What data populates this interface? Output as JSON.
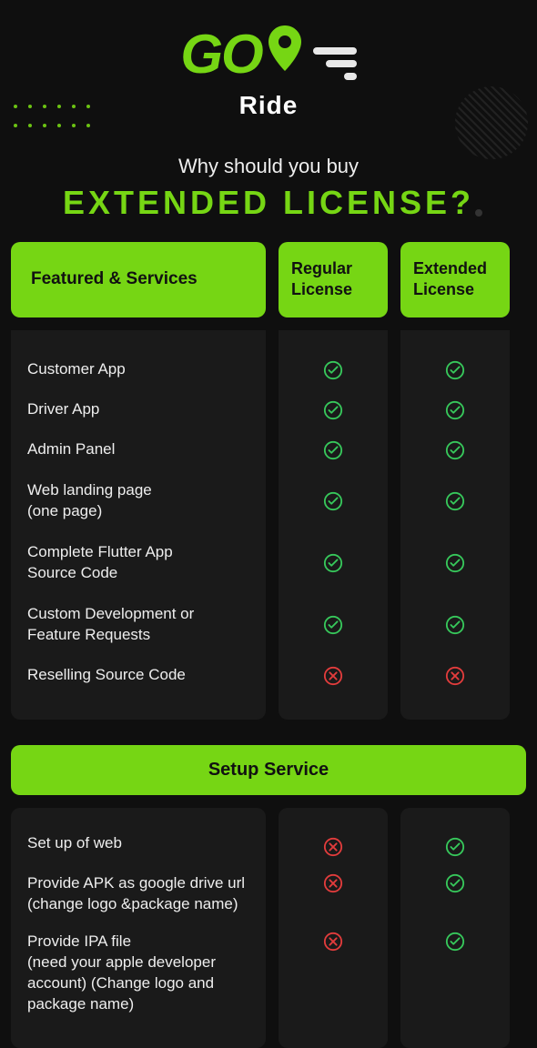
{
  "brand": {
    "name": "GO",
    "sub": "Ride"
  },
  "headline": {
    "top": "Why should you buy",
    "main": "EXTENDED LICENSE?"
  },
  "columns": {
    "features": "Featured & Services",
    "regular": "Regular License",
    "extended": "Extended License"
  },
  "features": [
    {
      "label": "Customer App",
      "regular": true,
      "extended": true,
      "tall": false
    },
    {
      "label": "Driver App",
      "regular": true,
      "extended": true,
      "tall": false
    },
    {
      "label": "Admin Panel",
      "regular": true,
      "extended": true,
      "tall": false
    },
    {
      "label": "Web landing page\n(one page)",
      "regular": true,
      "extended": true,
      "tall": true
    },
    {
      "label": "Complete Flutter App\nSource Code",
      "regular": true,
      "extended": true,
      "tall": true
    },
    {
      "label": "Custom Development or\nFeature Requests",
      "regular": true,
      "extended": true,
      "tall": true
    },
    {
      "label": "Reselling Source Code",
      "regular": false,
      "extended": false,
      "tall": false
    }
  ],
  "setup": {
    "header": "Setup Service",
    "rows": [
      {
        "label": "Set up of web",
        "regular": false,
        "extended": true,
        "h": "h1"
      },
      {
        "label": "Provide APK as google drive url (change logo &package name)",
        "regular": false,
        "extended": true,
        "h": "h2"
      },
      {
        "label": "Provide IPA file\n(need your apple developer account) (Change logo and package name)",
        "regular": false,
        "extended": true,
        "h": "h3"
      }
    ]
  },
  "icons": {
    "check": "check-icon",
    "cross": "cross-icon"
  },
  "colors": {
    "accent": "#76d614",
    "error": "#e23c3c"
  }
}
